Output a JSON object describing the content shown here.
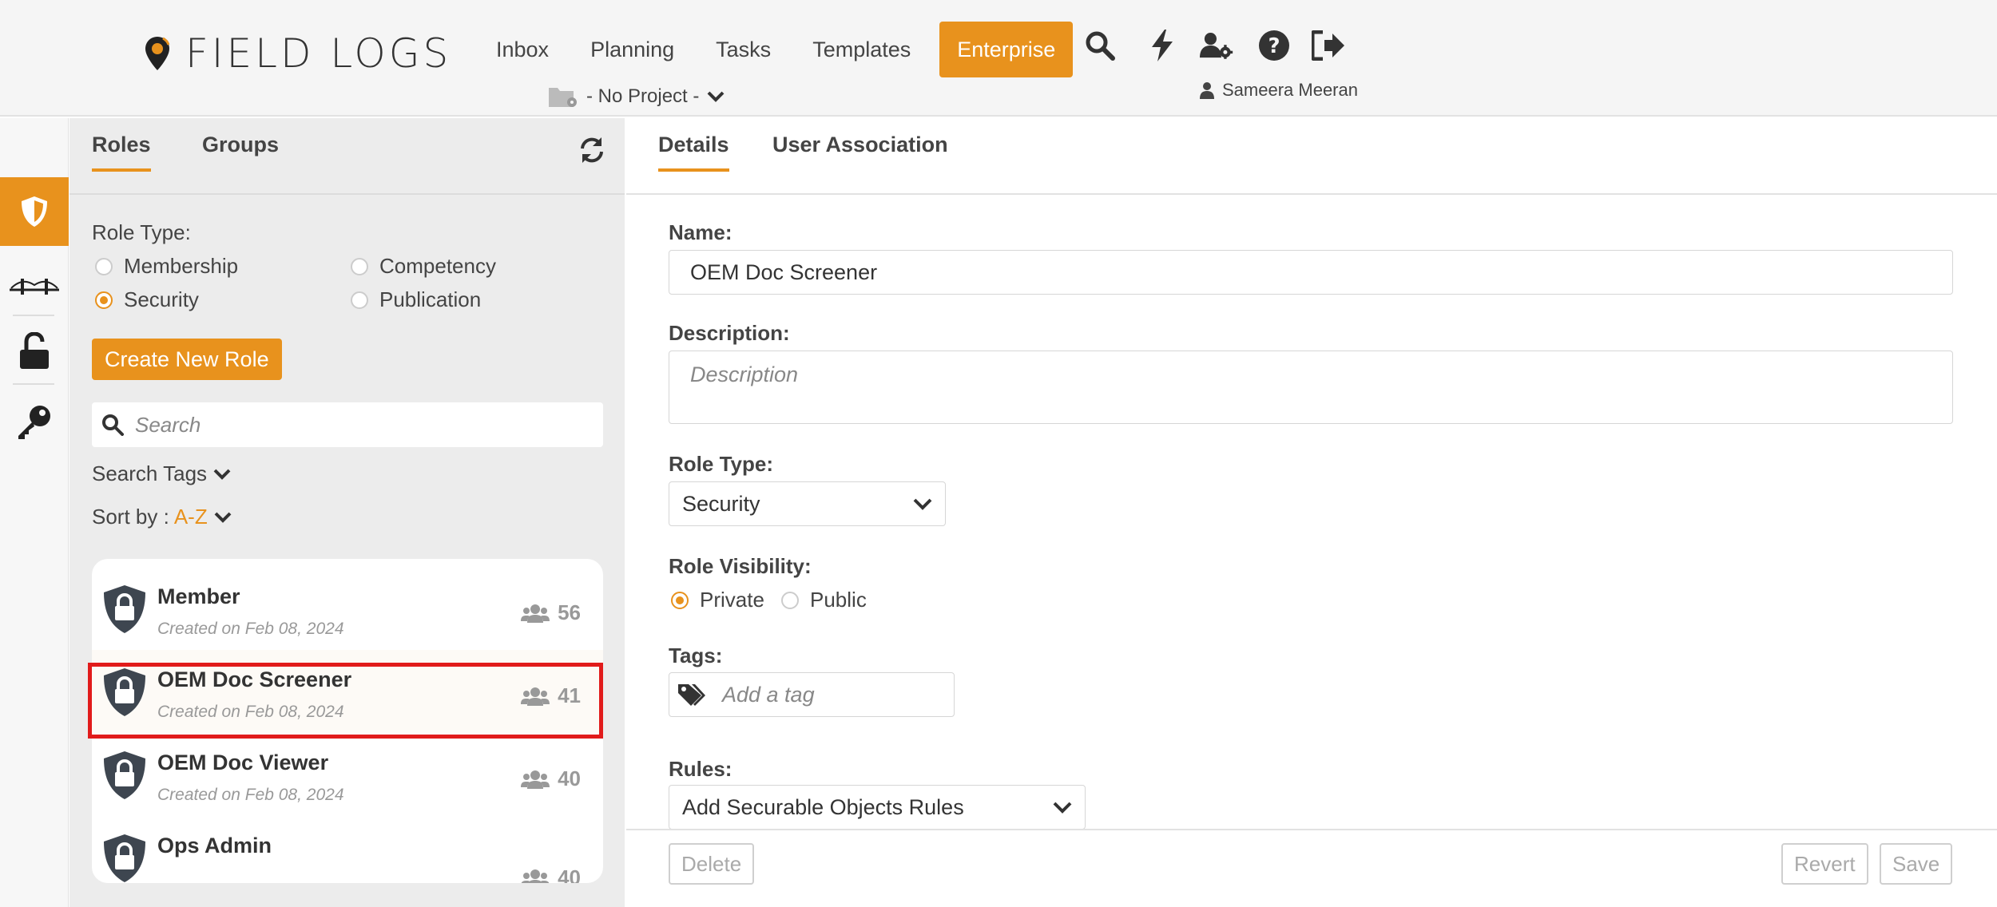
{
  "brand": {
    "name": "FIELD LOGS"
  },
  "nav": {
    "items": [
      {
        "label": "Inbox"
      },
      {
        "label": "Planning"
      },
      {
        "label": "Tasks"
      },
      {
        "label": "Templates"
      },
      {
        "label": "Enterprise"
      }
    ],
    "project_label": "- No Project -",
    "user_name": "Sameera Meeran"
  },
  "colors": {
    "accent": "#e8921d",
    "highlight": "#e11b1b"
  },
  "left_panel": {
    "tabs": [
      {
        "label": "Roles"
      },
      {
        "label": "Groups"
      }
    ],
    "role_type_label": "Role Type:",
    "role_types": [
      {
        "label": "Membership",
        "checked": false
      },
      {
        "label": "Competency",
        "checked": false
      },
      {
        "label": "Security",
        "checked": true
      },
      {
        "label": "Publication",
        "checked": false
      }
    ],
    "create_button": "Create New Role",
    "search_placeholder": "Search",
    "search_tags_label": "Search Tags",
    "sort_label": "Sort by :",
    "sort_value": "A-Z",
    "roles": [
      {
        "name": "Member",
        "created": "Created on Feb 08, 2024",
        "count": "56"
      },
      {
        "name": "OEM Doc Screener",
        "created": "Created on Feb 08, 2024",
        "count": "41"
      },
      {
        "name": "OEM Doc Viewer",
        "created": "Created on Feb 08, 2024",
        "count": "40"
      },
      {
        "name": "Ops Admin",
        "created": "",
        "count": "40"
      }
    ]
  },
  "right_panel": {
    "tabs": [
      {
        "label": "Details"
      },
      {
        "label": "User Association"
      }
    ],
    "name_label": "Name:",
    "name_value": "OEM Doc Screener",
    "description_label": "Description:",
    "description_placeholder": "Description",
    "role_type_label": "Role Type:",
    "role_type_value": "Security",
    "visibility_label": "Role Visibility:",
    "visibility_options": [
      {
        "label": "Private",
        "checked": true
      },
      {
        "label": "Public",
        "checked": false
      }
    ],
    "tags_label": "Tags:",
    "tags_placeholder": "Add a tag",
    "rules_label": "Rules:",
    "rules_value": "Add Securable Objects Rules",
    "delete_button": "Delete",
    "revert_button": "Revert",
    "save_button": "Save"
  }
}
